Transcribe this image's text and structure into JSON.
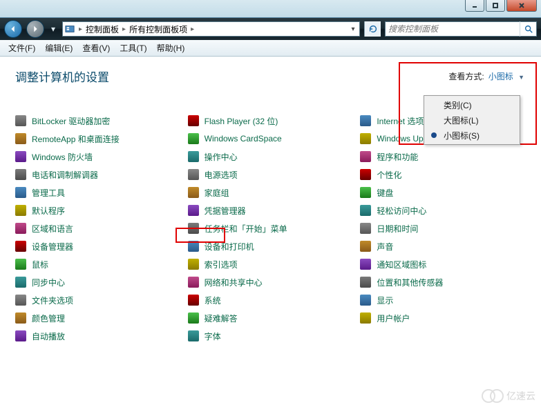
{
  "window": {
    "minimize": "–",
    "maximize": "☐",
    "close": "✕"
  },
  "breadcrumb": {
    "root_icon": "control-panel",
    "part1": "控制面板",
    "part2": "所有控制面板项"
  },
  "nav": {
    "refresh_tooltip": "刷新"
  },
  "search": {
    "placeholder": "搜索控制面板"
  },
  "menu": {
    "file": "文件(F)",
    "edit": "编辑(E)",
    "view": "查看(V)",
    "tools": "工具(T)",
    "help": "帮助(H)"
  },
  "heading": "调整计算机的设置",
  "view_label": "查看方式:",
  "view_value": "小图标",
  "view_options": {
    "category": "类别(C)",
    "large": "大图标(L)",
    "small": "小图标(S)"
  },
  "items": {
    "col1": [
      "BitLocker 驱动器加密",
      "RemoteApp 和桌面连接",
      "Windows 防火墙",
      "电话和调制解调器",
      "管理工具",
      "默认程序",
      "区域和语言",
      "设备管理器",
      "鼠标",
      "同步中心",
      "文件夹选项",
      "颜色管理",
      "自动播放"
    ],
    "col2": [
      "Flash Player (32 位)",
      "Windows CardSpace",
      "操作中心",
      "电源选项",
      "家庭组",
      "凭据管理器",
      "任务栏和「开始」菜单",
      "设备和打印机",
      "索引选项",
      "网络和共享中心",
      "系统",
      "疑难解答",
      "字体"
    ],
    "col3": [
      "Internet 选项",
      "Windows Update",
      "程序和功能",
      "个性化",
      "键盘",
      "轻松访问中心",
      "日期和时间",
      "声音",
      "通知区域图标",
      "位置和其他传感器",
      "显示",
      "用户帐户"
    ]
  },
  "watermark": "亿速云"
}
